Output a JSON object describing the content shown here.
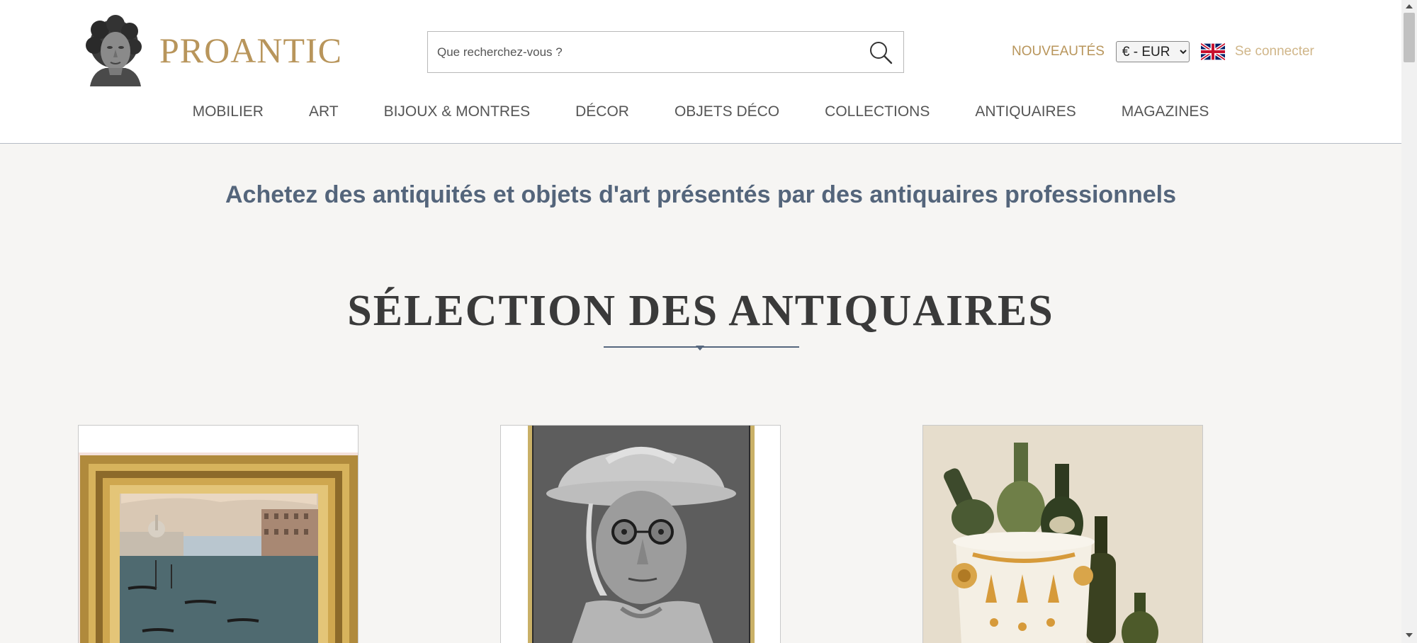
{
  "brand": {
    "name": "PROANTIC",
    "logo_icon": "classical-bust-logo",
    "color": "#b8955b"
  },
  "search": {
    "placeholder": "Que recherchez-vous ?",
    "icon": "search-icon"
  },
  "header_right": {
    "new_label": "NOUVEAUTÉS",
    "currency_selected": "€ - EUR",
    "language_icon": "uk-flag-icon",
    "login_label": "Se connecter"
  },
  "nav": {
    "items": [
      "MOBILIER",
      "ART",
      "BIJOUX & MONTRES",
      "DÉCOR",
      "OBJETS DÉCO",
      "COLLECTIONS",
      "ANTIQUAIRES",
      "MAGAZINES"
    ]
  },
  "tagline": "Achetez des antiquités et objets d'art présentés par des antiquaires professionnels",
  "section": {
    "title": "SÉLECTION DES ANTIQUAIRES"
  },
  "colors": {
    "accent_gold": "#b8955b",
    "tagline_blue": "#54657b",
    "page_bg": "#f6f5f3"
  }
}
